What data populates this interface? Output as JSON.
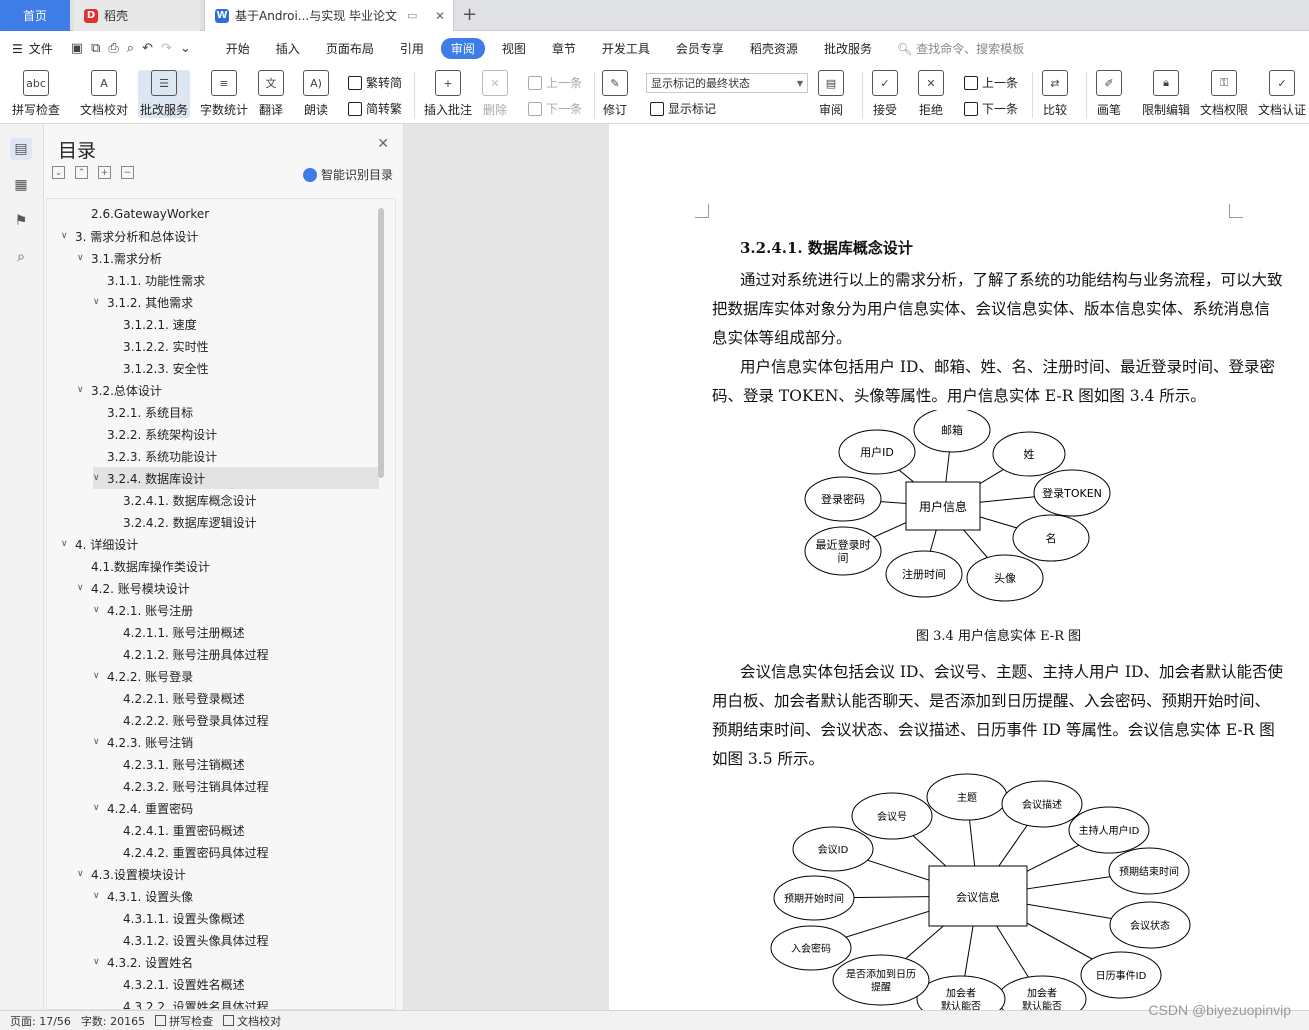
{
  "tabs": {
    "home": "首页",
    "daoke": "稻壳",
    "doc": "基于Androi...与实现 毕业论文",
    "add": "+"
  },
  "menubar": {
    "file": "文件",
    "items": [
      "开始",
      "插入",
      "页面布局",
      "引用",
      "审阅",
      "视图",
      "章节",
      "开发工具",
      "会员专享",
      "稻壳资源",
      "批改服务"
    ],
    "active": "审阅",
    "search": "查找命令、搜索模板"
  },
  "ribbon": {
    "spell": "拼写检查",
    "proof": "文档校对",
    "correct": "批改服务",
    "wordcount": "字数统计",
    "translate": "翻译",
    "read": "朗读",
    "trad": "繁转简",
    "simp": "简转繁",
    "insert_comment": "插入批注",
    "delete": "删除",
    "prev": "上一条",
    "next": "下一条",
    "revise": "修订",
    "display_select": "显示标记的最终状态",
    "show_marks": "显示标记",
    "review": "审阅",
    "accept": "接受",
    "reject": "拒绝",
    "prev2": "上一条",
    "next2": "下一条",
    "compare": "比较",
    "pen": "画笔",
    "restrict": "限制编辑",
    "perm": "文档权限",
    "cert": "文档认证"
  },
  "outline": {
    "title": "目录",
    "smart": "智能识别目录",
    "items": [
      {
        "text": "2.6.GatewayWorker",
        "level": 1,
        "arrow": false
      },
      {
        "text": "3.  需求分析和总体设计",
        "level": 0,
        "arrow": true
      },
      {
        "text": "3.1.需求分析",
        "level": 1,
        "arrow": true
      },
      {
        "text": "3.1.1.  功能性需求",
        "level": 2,
        "arrow": false
      },
      {
        "text": "3.1.2.  其他需求",
        "level": 2,
        "arrow": true
      },
      {
        "text": "3.1.2.1.  速度",
        "level": 3,
        "arrow": false
      },
      {
        "text": "3.1.2.2.  实时性",
        "level": 3,
        "arrow": false
      },
      {
        "text": "3.1.2.3.  安全性",
        "level": 3,
        "arrow": false
      },
      {
        "text": "3.2.总体设计",
        "level": 1,
        "arrow": true
      },
      {
        "text": "3.2.1.  系统目标",
        "level": 2,
        "arrow": false
      },
      {
        "text": "3.2.2.  系统架构设计",
        "level": 2,
        "arrow": false
      },
      {
        "text": "3.2.3.  系统功能设计",
        "level": 2,
        "arrow": false
      },
      {
        "text": "3.2.4.  数据库设计",
        "level": 2,
        "arrow": true,
        "selected": true
      },
      {
        "text": "3.2.4.1.  数据库概念设计",
        "level": 3,
        "arrow": false
      },
      {
        "text": "3.2.4.2.  数据库逻辑设计",
        "level": 3,
        "arrow": false
      },
      {
        "text": "4.  详细设计",
        "level": 0,
        "arrow": true
      },
      {
        "text": "4.1.数据库操作类设计",
        "level": 1,
        "arrow": false
      },
      {
        "text": "4.2.  账号模块设计",
        "level": 1,
        "arrow": true
      },
      {
        "text": "4.2.1.  账号注册",
        "level": 2,
        "arrow": true
      },
      {
        "text": "4.2.1.1.  账号注册概述",
        "level": 3,
        "arrow": false
      },
      {
        "text": "4.2.1.2.  账号注册具体过程",
        "level": 3,
        "arrow": false
      },
      {
        "text": "4.2.2.  账号登录",
        "level": 2,
        "arrow": true
      },
      {
        "text": "4.2.2.1.  账号登录概述",
        "level": 3,
        "arrow": false
      },
      {
        "text": "4.2.2.2.  账号登录具体过程",
        "level": 3,
        "arrow": false
      },
      {
        "text": "4.2.3.  账号注销",
        "level": 2,
        "arrow": true
      },
      {
        "text": "4.2.3.1.  账号注销概述",
        "level": 3,
        "arrow": false
      },
      {
        "text": "4.2.3.2.  账号注销具体过程",
        "level": 3,
        "arrow": false
      },
      {
        "text": "4.2.4.  重置密码",
        "level": 2,
        "arrow": true
      },
      {
        "text": "4.2.4.1.  重置密码概述",
        "level": 3,
        "arrow": false
      },
      {
        "text": "4.2.4.2.  重置密码具体过程",
        "level": 3,
        "arrow": false
      },
      {
        "text": "4.3.设置模块设计",
        "level": 1,
        "arrow": true
      },
      {
        "text": "4.3.1.  设置头像",
        "level": 2,
        "arrow": true
      },
      {
        "text": "4.3.1.1.  设置头像概述",
        "level": 3,
        "arrow": false
      },
      {
        "text": "4.3.1.2.  设置头像具体过程",
        "level": 3,
        "arrow": false
      },
      {
        "text": "4.3.2.  设置姓名",
        "level": 2,
        "arrow": true
      },
      {
        "text": "4.3.2.1.  设置姓名概述",
        "level": 3,
        "arrow": false
      },
      {
        "text": "4.3.2.2.  设置姓名具体过程",
        "level": 3,
        "arrow": false
      }
    ]
  },
  "doc": {
    "heading": "3.2.4.1.  数据库概念设计",
    "para1_lines": [
      "通过对系统进行以上的需求分析，了解了系统的功能结构与业务流程，可以大致",
      "把数据库实体对象分为用户信息实体、会议信息实体、版本信息实体、系统消息信",
      "息实体等组成部分。"
    ],
    "para2_lines": [
      "用户信息实体包括用户 ID、邮箱、姓、名、注册时间、最近登录时间、登录密",
      "码、登录 TOKEN、头像等属性。用户信息实体 E-R 图如图 3.4 所示。"
    ],
    "fig1": {
      "center": "用户信息",
      "attrs": [
        "用户ID",
        "邮箱",
        "姓",
        "登录TOKEN",
        "名",
        "头像",
        "注册时间",
        "最近登录时间",
        "登录密码"
      ],
      "caption": "图 3.4    用户信息实体 E-R 图"
    },
    "para3_lines": [
      "会议信息实体包括会议 ID、会议号、主题、主持人用户 ID、加会者默认能否使",
      "用白板、加会者默认能否聊天、是否添加到日历提醒、入会密码、预期开始时间、",
      "预期结束时间、会议状态、会议描述、日历事件 ID 等属性。会议信息实体 E-R 图",
      "如图 3.5 所示。"
    ],
    "fig2": {
      "center": "会议信息",
      "attrs": [
        "会议号",
        "主题",
        "会议描述",
        "主持人用户ID",
        "预期结束时间",
        "会议状态",
        "日历事件ID",
        "加会者默认能否",
        "加会者默认能否",
        "是否添加到日历提醒",
        "入会密码",
        "预期开始时间",
        "会议ID"
      ]
    }
  },
  "status": {
    "page": "页面: 17/56",
    "words": "字数: 20165",
    "spell": "拼写检查",
    "proof": "文档校对"
  },
  "watermark": "CSDN @biyezuopinvip",
  "colors": {
    "accent": "#3e7ce6"
  }
}
